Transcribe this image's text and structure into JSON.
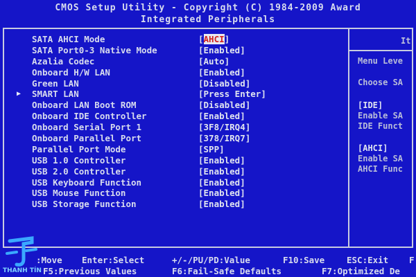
{
  "header": {
    "line1": "CMOS Setup Utility - Copyright (C) 1984-2009 Award",
    "line2": "Integrated Peripherals"
  },
  "items": [
    {
      "label": "SATA AHCI Mode",
      "value_open": "[",
      "value": "AHCI",
      "value_close": "]",
      "highlight": true,
      "arrow": false
    },
    {
      "label": "SATA Port0-3 Native Mode",
      "value_open": "[",
      "value": "Enabled",
      "value_close": "]",
      "highlight": false,
      "arrow": false
    },
    {
      "label": "Azalia Codec",
      "value_open": "[",
      "value": "Auto",
      "value_close": "]",
      "highlight": false,
      "arrow": false
    },
    {
      "label": "Onboard H/W LAN",
      "value_open": "[",
      "value": "Enabled",
      "value_close": "]",
      "highlight": false,
      "arrow": false
    },
    {
      "label": "Green LAN",
      "value_open": "[",
      "value": "Disabled",
      "value_close": "]",
      "highlight": false,
      "arrow": false
    },
    {
      "label": "SMART LAN",
      "value_open": "[",
      "value": "Press Enter",
      "value_close": "]",
      "highlight": false,
      "arrow": true
    },
    {
      "label": "Onboard LAN Boot ROM",
      "value_open": "[",
      "value": "Disabled",
      "value_close": "]",
      "highlight": false,
      "arrow": false
    },
    {
      "label": "Onboard IDE Controller",
      "value_open": "[",
      "value": "Enabled",
      "value_close": "]",
      "highlight": false,
      "arrow": false
    },
    {
      "label": "Onboard Serial Port 1",
      "value_open": "[",
      "value": "3F8/IRQ4",
      "value_close": "]",
      "highlight": false,
      "arrow": false
    },
    {
      "label": "Onboard Parallel Port",
      "value_open": "[",
      "value": "378/IRQ7",
      "value_close": "]",
      "highlight": false,
      "arrow": false
    },
    {
      "label": "Parallel Port Mode",
      "value_open": "[",
      "value": "SPP",
      "value_close": "]",
      "highlight": false,
      "arrow": false
    },
    {
      "label": "USB 1.0 Controller",
      "value_open": "[",
      "value": "Enabled",
      "value_close": "]",
      "highlight": false,
      "arrow": false
    },
    {
      "label": "USB 2.0 Controller",
      "value_open": "[",
      "value": "Enabled",
      "value_close": "]",
      "highlight": false,
      "arrow": false
    },
    {
      "label": "USB Keyboard Function",
      "value_open": "[",
      "value": "Enabled",
      "value_close": "]",
      "highlight": false,
      "arrow": false
    },
    {
      "label": "USB Mouse Function",
      "value_open": "[",
      "value": "Enabled",
      "value_close": "]",
      "highlight": false,
      "arrow": false
    },
    {
      "label": "USB Storage Function",
      "value_open": "[",
      "value": "Enabled",
      "value_close": "]",
      "highlight": false,
      "arrow": false
    }
  ],
  "help": {
    "title": "It",
    "menu_level": "Menu Leve",
    "choose": "Choose SA",
    "ide_tag": "[IDE]",
    "ide_line1": "Enable SA",
    "ide_line2": "IDE Funct",
    "ahci_tag": "[AHCI]",
    "ahci_line1": "Enable SA",
    "ahci_line2": "AHCI Func"
  },
  "footer": {
    "move": ":Move",
    "enter_select": "Enter:Select",
    "value": "+/-/PU/PD:Value",
    "save": "F10:Save",
    "exit": "ESC:Exit",
    "help": "F",
    "f5": "F5:Previous Values",
    "f6": "F6:Fail-Safe Defaults",
    "f7": "F7:Optimized De"
  },
  "watermark": {
    "text": "THANH TÍN"
  },
  "colors": {
    "background": "#1515c8",
    "text": "#d8dcee",
    "highlight_bg": "#e8e8f0",
    "highlight_fg": "#d02020"
  }
}
